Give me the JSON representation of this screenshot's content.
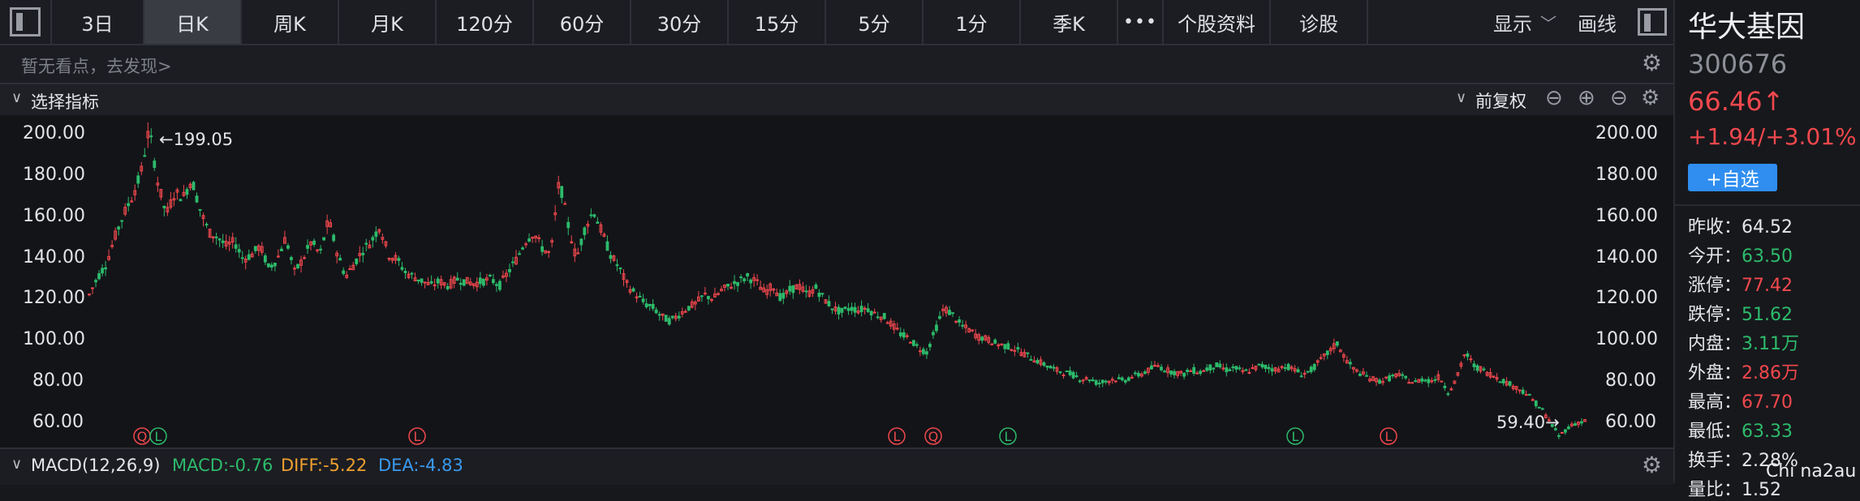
{
  "toolbar": {
    "tabs": [
      "3日",
      "日K",
      "周K",
      "月K",
      "120分",
      "60分",
      "30分",
      "15分",
      "5分",
      "1分",
      "季K"
    ],
    "active_tab": "日K",
    "more": "•••",
    "f10": "个股资料",
    "diagnose": "诊股",
    "display": "显示",
    "draw": "画线"
  },
  "viewpoint": {
    "text": "暂无看点，去发现>"
  },
  "indicator_bar": {
    "select": "选择指标",
    "adjust": "前复权"
  },
  "chart_data": {
    "type": "candlestick",
    "y_ticks": [
      "200.00",
      "180.00",
      "160.00",
      "140.00",
      "120.00",
      "100.00",
      "80.00",
      "60.00"
    ],
    "ylim": [
      55,
      205
    ],
    "high_label": "←199.05",
    "low_label": "59.40→",
    "high": 199.05,
    "low": 59.4,
    "path": [
      124,
      132,
      138,
      150,
      160,
      168,
      178,
      199,
      175,
      160,
      170,
      168,
      176,
      162,
      152,
      150,
      146,
      148,
      140,
      142,
      146,
      136,
      140,
      150,
      134,
      140,
      148,
      142,
      158,
      143,
      132,
      138,
      144,
      148,
      155,
      142,
      140,
      134,
      132,
      130,
      128,
      130,
      128,
      131,
      130,
      129,
      130,
      131,
      128,
      134,
      140,
      148,
      152,
      145,
      142,
      176,
      156,
      140,
      154,
      162,
      152,
      142,
      136,
      128,
      124,
      120,
      118,
      114,
      112,
      115,
      118,
      120,
      124,
      122,
      126,
      128,
      130,
      132,
      130,
      125,
      128,
      122,
      126,
      128,
      124,
      127,
      122,
      118,
      116,
      118,
      117,
      118,
      115,
      114,
      110,
      106,
      104,
      100,
      98,
      108,
      118,
      115,
      110,
      108,
      105,
      104,
      102,
      101,
      100,
      98,
      96,
      94,
      92,
      90,
      89,
      88,
      86,
      86,
      84,
      85,
      86,
      85,
      87,
      88,
      90,
      92,
      90,
      89,
      88,
      90,
      89,
      91,
      92,
      90,
      91,
      89,
      90,
      92,
      91,
      90,
      92,
      90,
      88,
      90,
      94,
      98,
      102,
      95,
      90,
      88,
      86,
      85,
      86,
      88,
      86,
      84,
      86,
      85,
      87,
      80,
      86,
      98,
      92,
      90,
      88,
      86,
      84,
      82,
      80,
      76,
      72,
      66,
      60,
      64,
      66,
      67
    ],
    "markers": [
      {
        "label": "Q",
        "type": "red",
        "x": 175
      },
      {
        "label": "L",
        "type": "green",
        "x": 195
      },
      {
        "label": "L",
        "type": "red",
        "x": 514
      },
      {
        "label": "L",
        "type": "red",
        "x": 1105
      },
      {
        "label": "Q",
        "type": "red",
        "x": 1150
      },
      {
        "label": "L",
        "type": "green",
        "x": 1242
      },
      {
        "label": "L",
        "type": "green",
        "x": 1596
      },
      {
        "label": "L",
        "type": "red",
        "x": 1711
      }
    ]
  },
  "macd": {
    "name": "MACD(12,26,9)",
    "macd": "MACD:-0.76",
    "diff": "DIFF:-5.22",
    "dea": "DEA:-4.83"
  },
  "stock": {
    "name": "华大基因",
    "code": "300676",
    "price": "66.46↑",
    "change": "+1.94/+3.01%",
    "watch_button": "+自选"
  },
  "stats": [
    {
      "k": "昨收：",
      "v": "64.52",
      "c": "white"
    },
    {
      "k": "今开：",
      "v": "63.50",
      "c": "green"
    },
    {
      "k": "涨停：",
      "v": "77.42",
      "c": "red"
    },
    {
      "k": "跌停：",
      "v": "51.62",
      "c": "green"
    },
    {
      "k": "内盘：",
      "v": "3.11万",
      "c": "green"
    },
    {
      "k": "外盘：",
      "v": "2.86万",
      "c": "red"
    },
    {
      "k": "最高：",
      "v": "67.70",
      "c": "red"
    },
    {
      "k": "最低：",
      "v": "63.33",
      "c": "green"
    },
    {
      "k": "换手：",
      "v": "2.28%",
      "c": "white"
    },
    {
      "k": "量比：",
      "v": "1.52",
      "c": "white"
    }
  ],
  "watermark": "Chi na2au",
  "colors": {
    "up": "#f0484d",
    "down": "#2dbb6b",
    "accent": "#2f8ef0"
  }
}
